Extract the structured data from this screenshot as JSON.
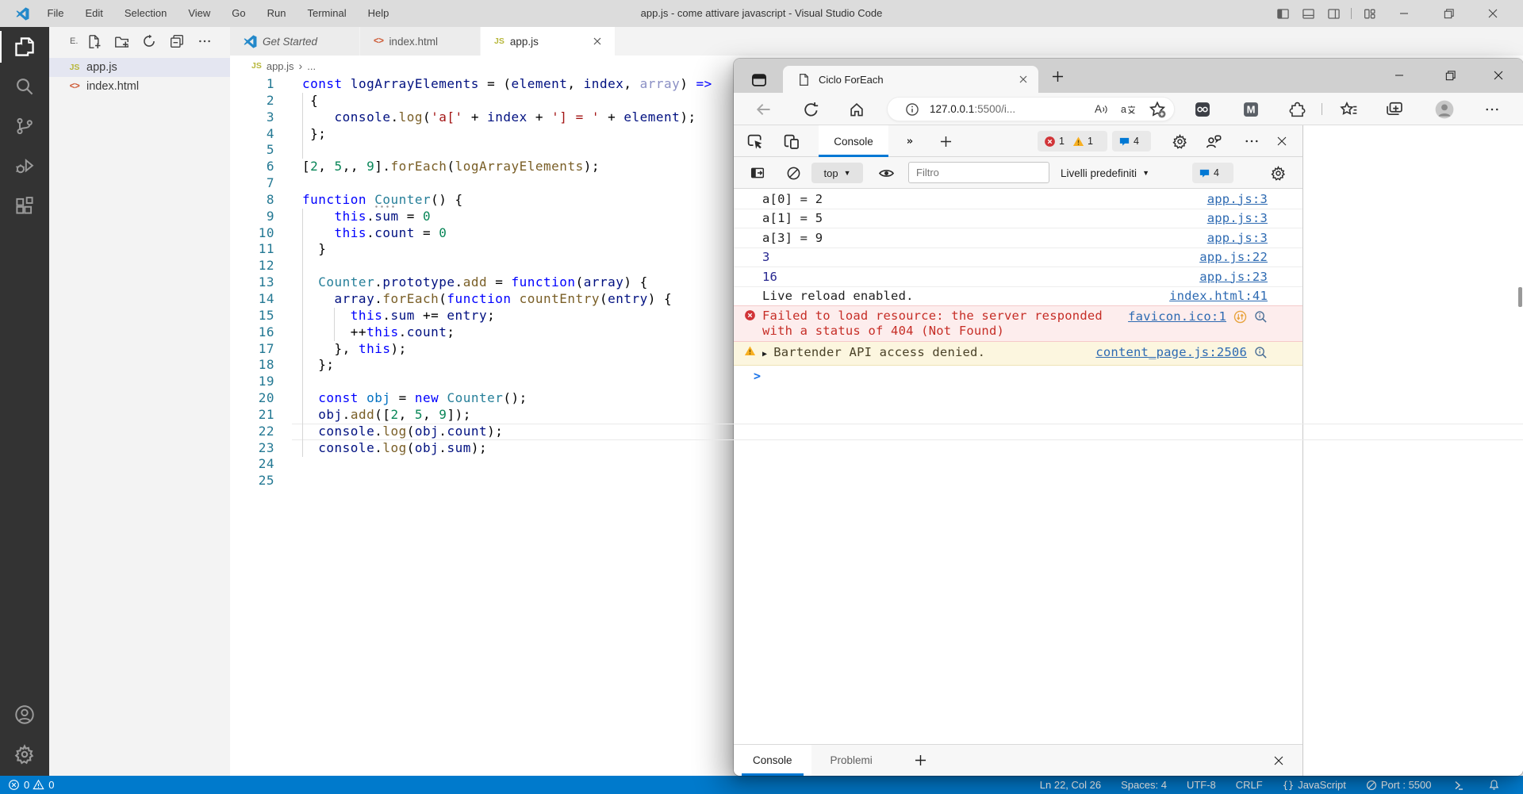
{
  "colors": {
    "accent_blue": "#007acc",
    "devtools_accent": "#0078d4",
    "error_red": "#c62d26",
    "warning_amber": "#f2b400",
    "link_blue": "#2d6ab2"
  },
  "vscode": {
    "title": "app.js - come attivare javascript - Visual Studio Code",
    "menu": [
      "File",
      "Edit",
      "Selection",
      "View",
      "Go",
      "Run",
      "Terminal",
      "Help"
    ],
    "activity_bar": {
      "top": [
        {
          "icon": "explorer",
          "active": true
        },
        {
          "icon": "search",
          "active": false
        },
        {
          "icon": "source-control",
          "active": false
        },
        {
          "icon": "run-debug",
          "active": false
        },
        {
          "icon": "extensions",
          "active": false
        }
      ],
      "bottom": [
        {
          "icon": "accounts"
        },
        {
          "icon": "settings"
        }
      ]
    },
    "explorer": {
      "header": "E.",
      "actions": [
        "new-file",
        "new-folder",
        "refresh",
        "collapse-all",
        "more"
      ],
      "files": [
        {
          "name": "app.js",
          "icon": "js",
          "selected": true
        },
        {
          "name": "index.html",
          "icon": "html",
          "selected": false
        }
      ]
    },
    "tabs": [
      {
        "label": "Get Started",
        "icon": "vscode-logo",
        "preview": true,
        "active": false,
        "close": false
      },
      {
        "label": "index.html",
        "icon": "html",
        "preview": false,
        "active": false,
        "close": false
      },
      {
        "label": "app.js",
        "icon": "js",
        "preview": false,
        "active": true,
        "close": true
      }
    ],
    "breadcrumb": {
      "file": "app.js",
      "more": "..."
    },
    "editor": {
      "current_line": 22,
      "hint_dots": {
        "line": 8,
        "col": 9
      },
      "indent_guides": [
        {
          "col": 0,
          "from": 2,
          "to": 5
        },
        {
          "col": 0,
          "from": 9,
          "to": 23
        },
        {
          "col": 4,
          "from": 15,
          "to": 16
        }
      ],
      "lines": [
        {
          "n": 1,
          "t": [
            [
              "k",
              "const"
            ],
            [
              "d",
              " "
            ],
            [
              "v",
              "logArrayElements"
            ],
            [
              "d",
              " = ("
            ],
            [
              "v",
              "element"
            ],
            [
              "d",
              ", "
            ],
            [
              "v",
              "index"
            ],
            [
              "d",
              ", "
            ],
            [
              "u",
              "array"
            ],
            [
              "d",
              ") "
            ],
            [
              "k",
              "=>"
            ]
          ]
        },
        {
          "n": 2,
          "t": [
            [
              "d",
              " {"
            ]
          ]
        },
        {
          "n": 3,
          "t": [
            [
              "d",
              "    "
            ],
            [
              "v",
              "console"
            ],
            [
              "d",
              "."
            ],
            [
              "f",
              "log"
            ],
            [
              "d",
              "("
            ],
            [
              "s",
              "'a['"
            ],
            [
              "d",
              " + "
            ],
            [
              "v",
              "index"
            ],
            [
              "d",
              " + "
            ],
            [
              "s",
              "'] = '"
            ],
            [
              "d",
              " + "
            ],
            [
              "v",
              "element"
            ],
            [
              "d",
              ");"
            ]
          ]
        },
        {
          "n": 4,
          "t": [
            [
              "d",
              " };"
            ]
          ]
        },
        {
          "n": 5,
          "t": []
        },
        {
          "n": 6,
          "t": [
            [
              "d",
              "["
            ],
            [
              "n",
              "2"
            ],
            [
              "d",
              ", "
            ],
            [
              "n",
              "5"
            ],
            [
              "d",
              ",, "
            ],
            [
              "n",
              "9"
            ],
            [
              "d",
              "]."
            ],
            [
              "f",
              "forEach"
            ],
            [
              "d",
              "("
            ],
            [
              "f",
              "logArrayElements"
            ],
            [
              "d",
              ");"
            ]
          ]
        },
        {
          "n": 7,
          "t": []
        },
        {
          "n": 8,
          "t": [
            [
              "k",
              "function"
            ],
            [
              "d",
              " "
            ],
            [
              "c",
              "Counter"
            ],
            [
              "d",
              "() {"
            ]
          ]
        },
        {
          "n": 9,
          "t": [
            [
              "d",
              "    "
            ],
            [
              "k",
              "this"
            ],
            [
              "d",
              "."
            ],
            [
              "v",
              "sum"
            ],
            [
              "d",
              " = "
            ],
            [
              "n",
              "0"
            ]
          ]
        },
        {
          "n": 10,
          "t": [
            [
              "d",
              "    "
            ],
            [
              "k",
              "this"
            ],
            [
              "d",
              "."
            ],
            [
              "v",
              "count"
            ],
            [
              "d",
              " = "
            ],
            [
              "n",
              "0"
            ]
          ]
        },
        {
          "n": 11,
          "t": [
            [
              "d",
              "  }"
            ]
          ]
        },
        {
          "n": 12,
          "t": []
        },
        {
          "n": 13,
          "t": [
            [
              "d",
              "  "
            ],
            [
              "c",
              "Counter"
            ],
            [
              "d",
              "."
            ],
            [
              "v",
              "prototype"
            ],
            [
              "d",
              "."
            ],
            [
              "f",
              "add"
            ],
            [
              "d",
              " = "
            ],
            [
              "k",
              "function"
            ],
            [
              "d",
              "("
            ],
            [
              "v",
              "array"
            ],
            [
              "d",
              ") {"
            ]
          ]
        },
        {
          "n": 14,
          "t": [
            [
              "d",
              "    "
            ],
            [
              "v",
              "array"
            ],
            [
              "d",
              "."
            ],
            [
              "f",
              "forEach"
            ],
            [
              "d",
              "("
            ],
            [
              "k",
              "function"
            ],
            [
              "d",
              " "
            ],
            [
              "f",
              "countEntry"
            ],
            [
              "d",
              "("
            ],
            [
              "v",
              "entry"
            ],
            [
              "d",
              ") {"
            ]
          ]
        },
        {
          "n": 15,
          "t": [
            [
              "d",
              "      "
            ],
            [
              "k",
              "this"
            ],
            [
              "d",
              "."
            ],
            [
              "v",
              "sum"
            ],
            [
              "d",
              " += "
            ],
            [
              "v",
              "entry"
            ],
            [
              "d",
              ";"
            ]
          ]
        },
        {
          "n": 16,
          "t": [
            [
              "d",
              "      ++"
            ],
            [
              "k",
              "this"
            ],
            [
              "d",
              "."
            ],
            [
              "v",
              "count"
            ],
            [
              "d",
              ";"
            ]
          ]
        },
        {
          "n": 17,
          "t": [
            [
              "d",
              "    }, "
            ],
            [
              "k",
              "this"
            ],
            [
              "d",
              ");"
            ]
          ]
        },
        {
          "n": 18,
          "t": [
            [
              "d",
              "  };"
            ]
          ]
        },
        {
          "n": 19,
          "t": []
        },
        {
          "n": 20,
          "t": [
            [
              "d",
              "  "
            ],
            [
              "k",
              "const"
            ],
            [
              "d",
              " "
            ],
            [
              "b",
              "obj"
            ],
            [
              "d",
              " = "
            ],
            [
              "k",
              "new"
            ],
            [
              "d",
              " "
            ],
            [
              "c",
              "Counter"
            ],
            [
              "d",
              "();"
            ]
          ]
        },
        {
          "n": 21,
          "t": [
            [
              "d",
              "  "
            ],
            [
              "v",
              "obj"
            ],
            [
              "d",
              "."
            ],
            [
              "f",
              "add"
            ],
            [
              "d",
              "(["
            ],
            [
              "n",
              "2"
            ],
            [
              "d",
              ", "
            ],
            [
              "n",
              "5"
            ],
            [
              "d",
              ", "
            ],
            [
              "n",
              "9"
            ],
            [
              "d",
              "]);"
            ]
          ]
        },
        {
          "n": 22,
          "t": [
            [
              "d",
              "  "
            ],
            [
              "v",
              "console"
            ],
            [
              "d",
              "."
            ],
            [
              "f",
              "log"
            ],
            [
              "d",
              "("
            ],
            [
              "v",
              "obj"
            ],
            [
              "d",
              "."
            ],
            [
              "v",
              "count"
            ],
            [
              "d",
              ");"
            ]
          ]
        },
        {
          "n": 23,
          "t": [
            [
              "d",
              "  "
            ],
            [
              "v",
              "console"
            ],
            [
              "d",
              "."
            ],
            [
              "f",
              "log"
            ],
            [
              "d",
              "("
            ],
            [
              "v",
              "obj"
            ],
            [
              "d",
              "."
            ],
            [
              "v",
              "sum"
            ],
            [
              "d",
              ");"
            ]
          ]
        },
        {
          "n": 24,
          "t": []
        },
        {
          "n": 25,
          "t": []
        }
      ]
    },
    "status_bar": {
      "left": [
        {
          "icon": "error-circle",
          "text": "0"
        },
        {
          "icon": "warning-triangle",
          "text": "0"
        }
      ],
      "right": [
        {
          "icon": "",
          "text": "Ln 22, Col 26"
        },
        {
          "icon": "",
          "text": "Spaces: 4"
        },
        {
          "icon": "",
          "text": "UTF-8"
        },
        {
          "icon": "",
          "text": "CRLF"
        },
        {
          "icon": "braces",
          "text": "JavaScript"
        },
        {
          "icon": "blocked",
          "text": "Port : 5500"
        },
        {
          "icon": "remote",
          "text": ""
        },
        {
          "icon": "bell",
          "text": ""
        }
      ]
    },
    "title_bar_actions": [
      "layout-sidebar-left",
      "layout-panel",
      "layout-sidebar-right",
      "sep",
      "layout-customize",
      "minimize",
      "restore",
      "close"
    ]
  },
  "edge": {
    "tab": {
      "title": "Ciclo ForEach"
    },
    "toolbar": {
      "url_host": "127.0.0.1",
      "url_rest": ":5500/i..."
    },
    "devtools": {
      "active_tab": "Console",
      "badges": {
        "errors": "1",
        "warnings": "1",
        "messages": "4"
      },
      "console_toolbar": {
        "context": "top",
        "filter_placeholder": "Filtro",
        "levels_label": "Livelli predefiniti",
        "messages_count": "4"
      },
      "messages": [
        {
          "type": "log",
          "text": "a[0] = 2",
          "link": "app.js:3"
        },
        {
          "type": "log",
          "text": "a[1] = 5",
          "link": "app.js:3"
        },
        {
          "type": "log",
          "text": "a[3] = 9",
          "link": "app.js:3"
        },
        {
          "type": "result",
          "text": "3",
          "link": "app.js:22"
        },
        {
          "type": "result",
          "text": "16",
          "link": "app.js:23"
        },
        {
          "type": "log",
          "text": "Live reload enabled.",
          "link": "index.html:41"
        },
        {
          "type": "error",
          "text": "Failed to load resource: the server responded with a status of 404 (Not Found)",
          "link": "favicon.ico:1"
        },
        {
          "type": "warning",
          "text": "Bartender API access denied.",
          "link": "content_page.js:2506"
        }
      ],
      "drawer_tabs": [
        {
          "label": "Console",
          "active": true
        },
        {
          "label": "Problemi",
          "active": false
        }
      ]
    }
  }
}
